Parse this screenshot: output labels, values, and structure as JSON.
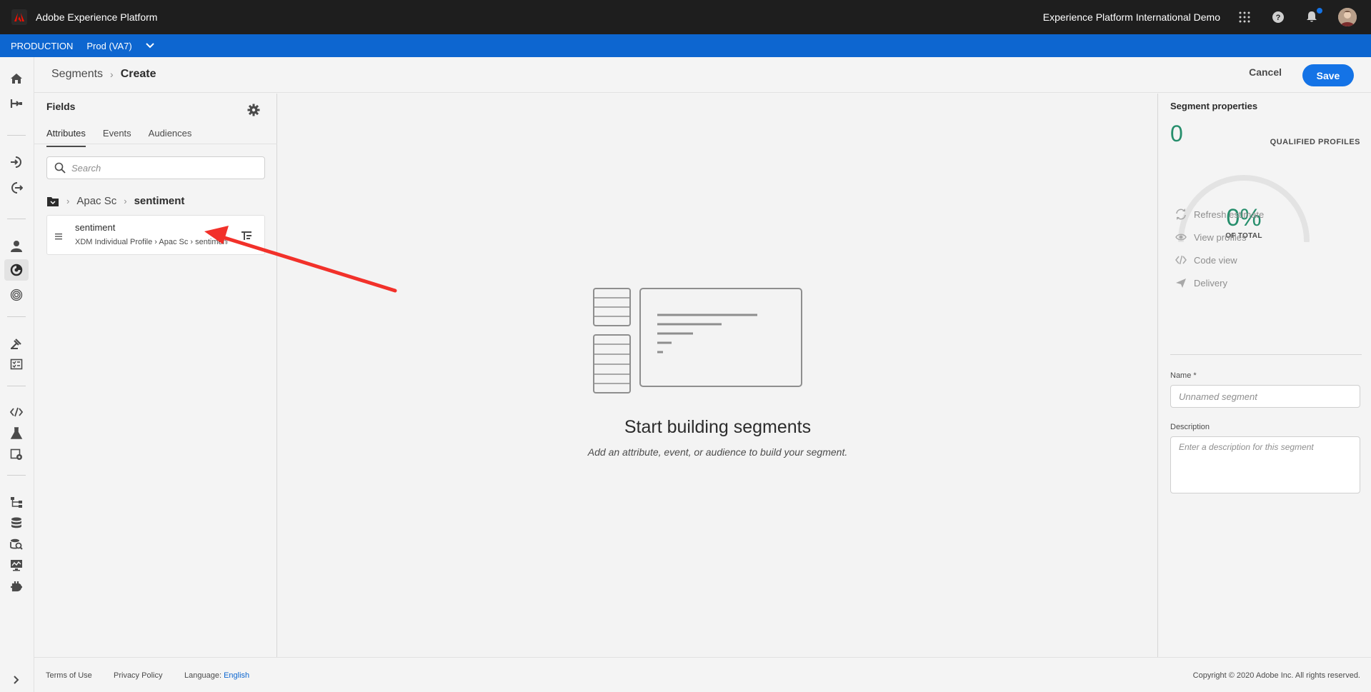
{
  "topbar": {
    "app_name": "Adobe Experience Platform",
    "org_name": "Experience Platform International Demo",
    "icons": [
      "apps-grid-icon",
      "help-icon",
      "bell-icon",
      "avatar"
    ],
    "notification_dot_color": "#1473e6"
  },
  "envbar": {
    "environment": "PRODUCTION",
    "sandbox": "Prod (VA7)",
    "background": "#0d66d0"
  },
  "rail": {
    "icons": [
      "home-icon",
      "workflows-icon",
      "sources-icon",
      "destinations-icon",
      "profiles-icon",
      "segments-icon",
      "identities-icon",
      "policies-icon",
      "schemas-icon",
      "queries-icon",
      "notebooks-icon",
      "sandboxes-icon",
      "data-governance-icon",
      "datasets-icon",
      "monitoring-icon",
      "dashboards-icon",
      "plugins-icon"
    ],
    "active": "segments-icon"
  },
  "header": {
    "breadcrumb_parent": "Segments",
    "breadcrumb_current": "Create",
    "cancel_label": "Cancel",
    "save_label": "Save"
  },
  "fields_panel": {
    "title": "Fields",
    "tabs": [
      {
        "label": "Attributes",
        "active": true
      },
      {
        "label": "Events",
        "active": false
      },
      {
        "label": "Audiences",
        "active": false
      }
    ],
    "search_placeholder": "Search",
    "path": [
      "Apac Sc",
      "sentiment"
    ],
    "field_item": {
      "name": "sentiment",
      "path": "XDM Individual Profile › Apac Sc › sentiment"
    }
  },
  "canvas": {
    "empty_title": "Start building segments",
    "empty_subtitle": "Add an attribute, event, or audience to build your segment."
  },
  "properties": {
    "title": "Segment properties",
    "qualified_count": "0",
    "qualified_label": "QUALIFIED PROFILES",
    "percent": "0%",
    "percent_label": "OF TOTAL",
    "actions": [
      {
        "label": "Refresh estimate",
        "icon": "refresh-icon"
      },
      {
        "label": "View profiles",
        "icon": "eye-icon"
      },
      {
        "label": "Code view",
        "icon": "code-icon"
      },
      {
        "label": "Delivery",
        "icon": "send-icon"
      }
    ],
    "name_label": "Name *",
    "name_placeholder": "Unnamed segment",
    "description_label": "Description",
    "description_placeholder": "Enter a description for this segment",
    "accent_color": "#268e6c"
  },
  "footer": {
    "terms": "Terms of Use",
    "privacy": "Privacy Policy",
    "language_label": "Language:",
    "language_value": "English",
    "copyright": "Copyright © 2020 Adobe Inc. All rights reserved."
  },
  "annotation": {
    "arrow_color": "#f2312a"
  }
}
